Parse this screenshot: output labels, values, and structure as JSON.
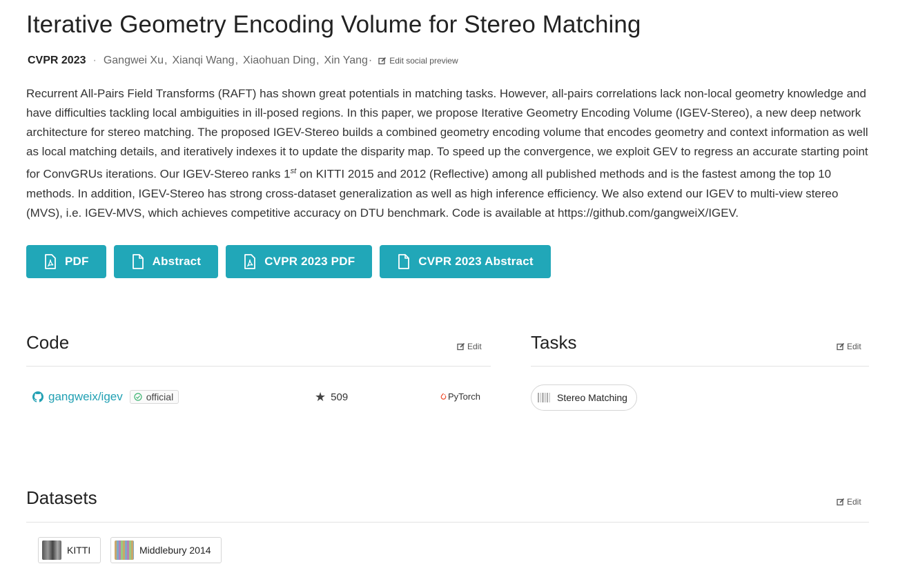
{
  "paper": {
    "title": "Iterative Geometry Encoding Volume for Stereo Matching",
    "venue": "CVPR 2023",
    "authors": [
      "Gangwei Xu",
      "Xianqi Wang",
      "Xiaohuan Ding",
      "Xin Yang"
    ],
    "edit_social_preview": "Edit social preview",
    "abstract_part1": "Recurrent All-Pairs Field Transforms (RAFT) has shown great potentials in matching tasks. However, all-pairs correlations lack non-local geometry knowledge and have difficulties tackling local ambiguities in ill-posed regions. In this paper, we propose Iterative Geometry Encoding Volume (IGEV-Stereo), a new deep network architecture for stereo matching. The proposed IGEV-Stereo builds a combined geometry encoding volume that encodes geometry and context information as well as local matching details, and iteratively indexes it to update the disparity map. To speed up the convergence, we exploit GEV to regress an accurate starting point for ConvGRUs iterations. Our IGEV-Stereo ranks 1",
    "abstract_sup": "st",
    "abstract_part2": " on KITTI 2015 and 2012 (Reflective) among all published methods and is the fastest among the top 10 methods. In addition, IGEV-Stereo has strong cross-dataset generalization as well as high inference efficiency. We also extend our IGEV to multi-view stereo (MVS), i.e. IGEV-MVS, which achieves competitive accuracy on DTU benchmark. Code is available at https://github.com/gangweiX/IGEV."
  },
  "buttons": {
    "pdf": "PDF",
    "abstract": "Abstract",
    "venue_pdf": "CVPR 2023 PDF",
    "venue_abstract": "CVPR 2023 Abstract"
  },
  "code": {
    "heading": "Code",
    "edit": "Edit",
    "repo": "gangweix/igev",
    "official": "official",
    "stars": "509",
    "framework": "PyTorch"
  },
  "tasks": {
    "heading": "Tasks",
    "edit": "Edit",
    "items": [
      "Stereo Matching"
    ]
  },
  "datasets": {
    "heading": "Datasets",
    "edit": "Edit",
    "items": [
      "KITTI",
      "Middlebury 2014"
    ]
  },
  "colors": {
    "accent": "#21a7b8",
    "link": "#21a0b3",
    "official_check": "#3cb371",
    "pytorch": "#ee4c2c"
  }
}
